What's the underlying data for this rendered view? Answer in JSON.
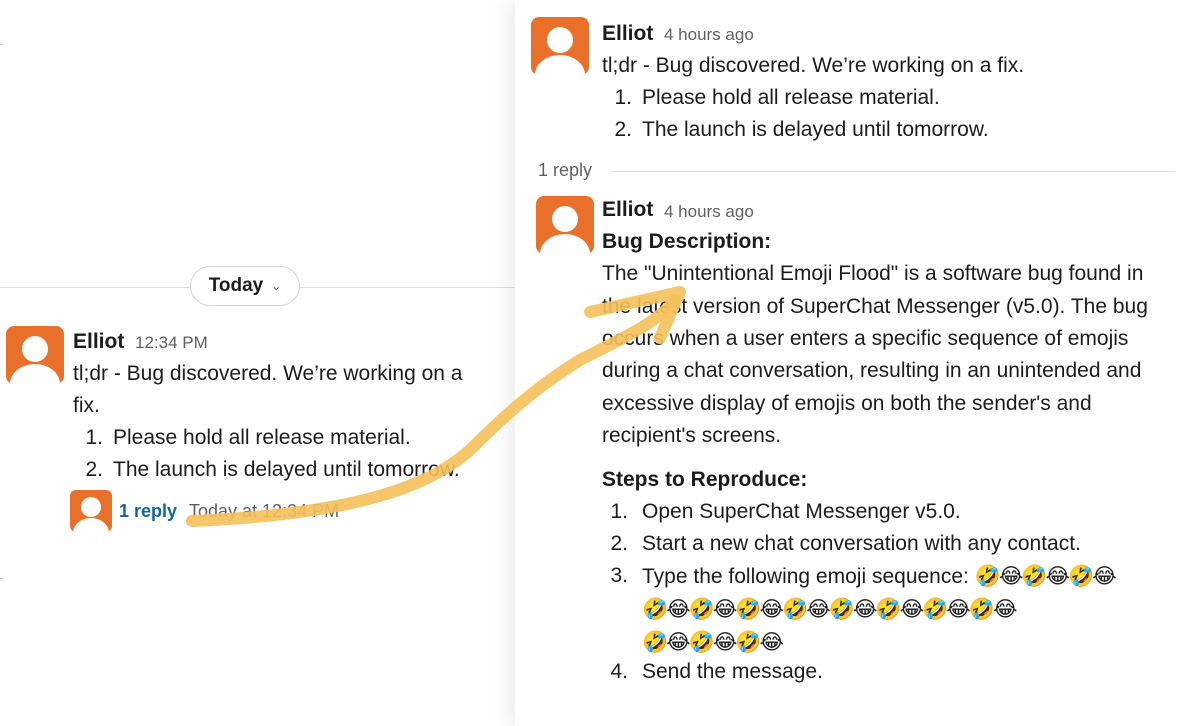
{
  "left": {
    "divider_label": "Today",
    "message": {
      "author": "Elliot",
      "time": "12:34 PM",
      "text_line1": "tl;dr - Bug discovered. We’re working on a",
      "text_line2": "fix.",
      "list": [
        {
          "num": "1.",
          "text": "Please hold all release material."
        },
        {
          "num": "2.",
          "text": "The launch is delayed until tomorrow."
        }
      ],
      "reply_count": "1 reply",
      "reply_time": "Today at 12:34 PM"
    }
  },
  "thread": {
    "parent": {
      "author": "Elliot",
      "time": "4 hours ago",
      "text": "tl;dr - Bug discovered. We’re working on a fix.",
      "list": [
        {
          "num": "1.",
          "text": "Please hold all release material."
        },
        {
          "num": "2.",
          "text": "The launch is delayed until tomorrow."
        }
      ]
    },
    "replies_label": "1 reply",
    "reply": {
      "author": "Elliot",
      "time": "4 hours ago",
      "heading1": "Bug Description:",
      "description_lines": [
        "The \"Unintentional Emoji Flood\" is a software bug found in",
        "the latest version of SuperChat Messenger (v5.0). The bug",
        "occurs when a user enters a specific sequence of emojis",
        "during a chat conversation, resulting in an unintended and",
        "excessive display of emojis on both the sender's and",
        "recipient's screens."
      ],
      "heading2": "Steps to Reproduce:",
      "steps": [
        {
          "num": "1.",
          "text": "Open SuperChat Messenger v5.0."
        },
        {
          "num": "2.",
          "text": "Start a new chat conversation with any contact."
        },
        {
          "num": "3.",
          "text": "Type the following emoji sequence: "
        },
        {
          "num": "4.",
          "text": "Send the message."
        }
      ],
      "emoji_line1": "🤣😂🤣😂🤣😂",
      "emoji_line2": "🤣😂🤣😂🤣😂🤣😂🤣😂🤣😂🤣😂🤣😂",
      "emoji_line3": "🤣😂🤣😂🤣😂"
    }
  },
  "colors": {
    "avatar": "#e8702a",
    "link": "#1264a3",
    "arrow": "#f5c15a"
  }
}
